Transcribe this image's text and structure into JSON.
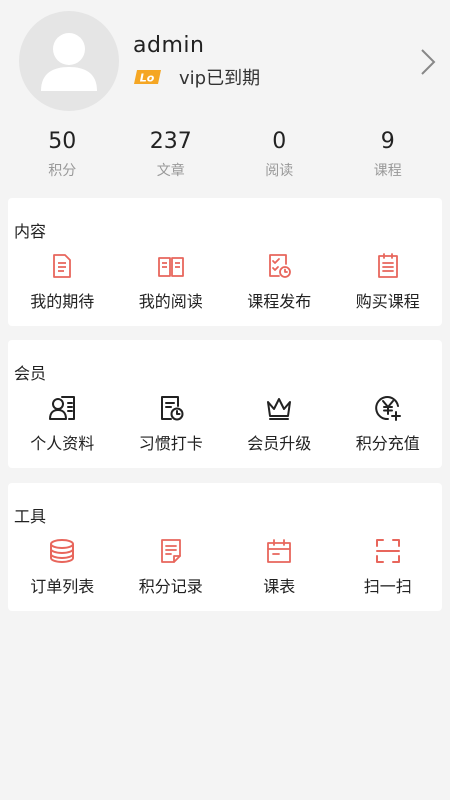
{
  "profile": {
    "username": "admin",
    "vip_badge": "Lo",
    "vip_status": "vip已到期"
  },
  "stats": [
    {
      "value": "50",
      "label": "积分"
    },
    {
      "value": "237",
      "label": "文章"
    },
    {
      "value": "0",
      "label": "阅读"
    },
    {
      "value": "9",
      "label": "课程"
    }
  ],
  "sections": [
    {
      "title": "内容",
      "items": [
        {
          "label": "我的期待",
          "icon": "document-icon"
        },
        {
          "label": "我的阅读",
          "icon": "book-icon"
        },
        {
          "label": "课程发布",
          "icon": "checklist-clock-icon"
        },
        {
          "label": "购买课程",
          "icon": "notepad-icon"
        }
      ]
    },
    {
      "title": "会员",
      "items": [
        {
          "label": "个人资料",
          "icon": "user-card-icon"
        },
        {
          "label": "习惯打卡",
          "icon": "clipboard-clock-icon"
        },
        {
          "label": "会员升级",
          "icon": "crown-icon"
        },
        {
          "label": "积分充值",
          "icon": "yen-plus-icon"
        }
      ]
    },
    {
      "title": "工具",
      "items": [
        {
          "label": "订单列表",
          "icon": "database-icon"
        },
        {
          "label": "积分记录",
          "icon": "record-icon"
        },
        {
          "label": "课表",
          "icon": "calendar-icon"
        },
        {
          "label": "扫一扫",
          "icon": "scan-icon"
        }
      ]
    }
  ],
  "colors": {
    "accent": "#e8665c",
    "dark_icon": "#222222",
    "badge": "#f5a623",
    "page_bg": "#f4f4f4"
  }
}
